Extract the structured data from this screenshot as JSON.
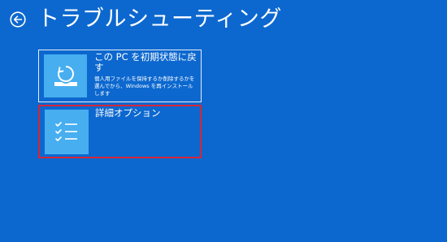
{
  "header": {
    "back_icon": "back-arrow-icon",
    "title": "トラブルシューティング"
  },
  "tiles": [
    {
      "icon": "reset-pc-icon",
      "title": "この PC を初期状態に戻す",
      "description": "個人用ファイルを保持するか削除するかを選んでから、Windows を再インストールします"
    },
    {
      "icon": "checklist-icon",
      "title": "詳細オプション",
      "description": ""
    }
  ],
  "colors": {
    "background": "#0c68cf",
    "tile_icon_bg": "#47aef0",
    "selection_border": "#d42639"
  }
}
